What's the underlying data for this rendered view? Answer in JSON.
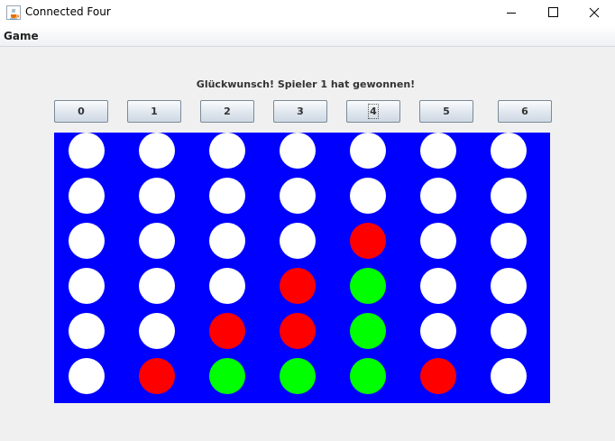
{
  "window": {
    "title": "Connected Four",
    "icon": "java-cup-icon",
    "controls": [
      "minimize-icon",
      "maximize-icon",
      "close-icon"
    ]
  },
  "menubar": {
    "items": [
      "Game"
    ]
  },
  "status_message": "Glückwunsch! Spieler 1 hat gewonnen!",
  "column_buttons": [
    "0",
    "1",
    "2",
    "3",
    "4",
    "5",
    "6"
  ],
  "focused_column": "4",
  "colors": {
    "board": "#0000ff",
    "empty": "#ffffff",
    "red": "#ff0000",
    "green": "#00ff00"
  },
  "board": {
    "rows": 6,
    "columns": 7,
    "cells": [
      [
        "empty",
        "empty",
        "empty",
        "empty",
        "empty",
        "empty",
        "empty"
      ],
      [
        "empty",
        "empty",
        "empty",
        "empty",
        "empty",
        "empty",
        "empty"
      ],
      [
        "empty",
        "empty",
        "empty",
        "empty",
        "red",
        "empty",
        "empty"
      ],
      [
        "empty",
        "empty",
        "empty",
        "red",
        "green",
        "empty",
        "empty"
      ],
      [
        "empty",
        "empty",
        "red",
        "red",
        "green",
        "empty",
        "empty"
      ],
      [
        "empty",
        "red",
        "green",
        "green",
        "green",
        "red",
        "empty"
      ]
    ]
  }
}
